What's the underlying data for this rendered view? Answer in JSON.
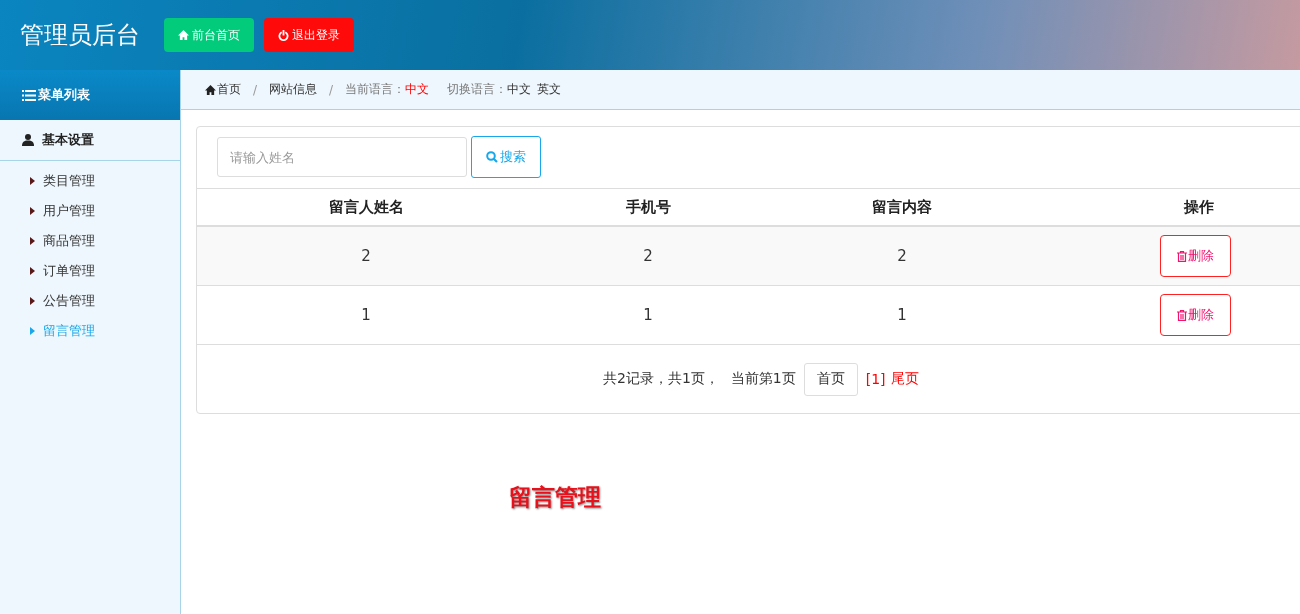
{
  "header": {
    "title": "管理员后台",
    "buttons": [
      {
        "kind": "home",
        "label": "前台首页"
      },
      {
        "kind": "logout",
        "label": "退出登录"
      }
    ]
  },
  "sidebar": {
    "title": "菜单列表",
    "group": {
      "label": "基本设置",
      "items": [
        {
          "label": "类目管理",
          "selected": false
        },
        {
          "label": "用户管理",
          "selected": false
        },
        {
          "label": "商品管理",
          "selected": false
        },
        {
          "label": "订单管理",
          "selected": false
        },
        {
          "label": "公告管理",
          "selected": false
        },
        {
          "label": "留言管理",
          "selected": true
        }
      ]
    }
  },
  "breadcrumb": {
    "separator": "/",
    "items": [
      {
        "kind": "home",
        "label": "首页"
      },
      {
        "kind": "link",
        "label": "网站信息"
      }
    ],
    "current_language_label": "当前语言：",
    "current_language": "中文",
    "switch_label": "切换语言：",
    "languages": [
      "中文",
      "英文"
    ]
  },
  "search": {
    "placeholder": "请输入姓名",
    "button": "搜索"
  },
  "table": {
    "columns": [
      "留言人姓名",
      "手机号",
      "留言内容",
      "操作"
    ],
    "rows": [
      {
        "cells": [
          "2",
          "2",
          "2"
        ],
        "action": "删除"
      },
      {
        "cells": [
          "1",
          "1",
          "1"
        ],
        "action": "删除"
      }
    ]
  },
  "pagination": {
    "summary": "共2记录，共1页，",
    "current": "当前第1页",
    "first": "首页",
    "page": "[1]",
    "last": "尾页"
  },
  "page_title": "留言管理"
}
